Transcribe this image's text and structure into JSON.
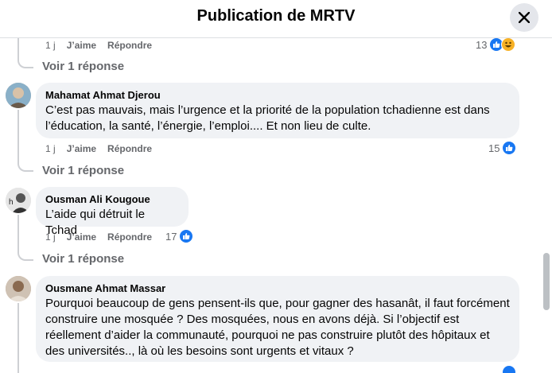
{
  "header": {
    "title": "Publication de MRTV"
  },
  "top_fragment": {
    "time": "1 j",
    "like_label": "J’aime",
    "reply_label": "Répondre",
    "reaction_count": "13",
    "view_replies": "Voir 1 réponse"
  },
  "comments": [
    {
      "author": "Mahamat Ahmat Djerou",
      "text": "C’est pas mauvais, mais l’urgence et la priorité de la population tchadienne est dans l’éducation, la santé, l’énergie, l’emploi.... Et non lieu de culte.",
      "time": "1 j",
      "like_label": "J’aime",
      "reply_label": "Répondre",
      "reaction_count": "15",
      "view_replies": "Voir 1 réponse"
    },
    {
      "author": "Ousman Ali Kougoue",
      "text": "L’aide qui détruit le Tchad",
      "time": "1 j",
      "like_label": "J’aime",
      "reply_label": "Répondre",
      "reaction_count": "17",
      "view_replies": "Voir 1 réponse"
    },
    {
      "author": "Ousmane Ahmat Massar",
      "text": "Pourquoi beaucoup de gens pensent-ils que, pour gagner des hasanât, il faut forcément construire une mosquée ? Des mosquées, nous en avons déjà. Si l’objectif est réellement d’aider la communauté, pourquoi ne pas construire plutôt des hôpitaux et des universités.., là où les besoins sont urgents et vitaux ?"
    }
  ],
  "icons": {
    "like": "like-icon",
    "haha": "haha-icon",
    "close": "close-icon"
  },
  "colors": {
    "accent": "#1877f2",
    "bubble": "#f0f2f5",
    "muted": "#65676b"
  }
}
